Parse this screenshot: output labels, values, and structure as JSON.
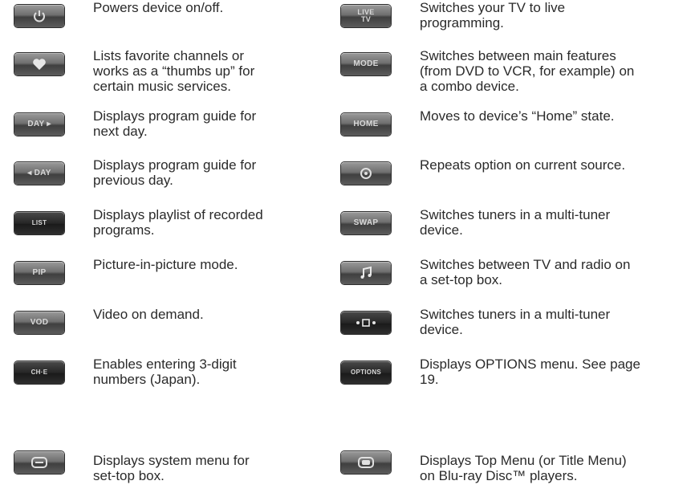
{
  "left": [
    {
      "button": "",
      "icon": "power-icon",
      "desc": "Powers device on/off."
    },
    {
      "button": "",
      "icon": "heart-icon",
      "desc": "Lists favorite channels or\nworks as a “thumbs up” for\ncertain music services."
    },
    {
      "button": "DAY ▸",
      "icon": "day-next-label",
      "desc": "Displays program guide for\nnext day."
    },
    {
      "button": "◂ DAY",
      "icon": "day-prev-label",
      "desc": "Displays program guide for\nprevious day."
    },
    {
      "button": "LIST",
      "icon": "list-label",
      "desc": "Displays playlist of recorded\nprograms."
    },
    {
      "button": "PIP",
      "icon": "pip-label",
      "desc": "Picture-in-picture mode."
    },
    {
      "button": "VOD",
      "icon": "vod-label",
      "desc": "Video on demand."
    },
    {
      "button": "CH·E",
      "icon": "ch-e-label",
      "desc": "Enables entering 3-digit\nnumbers (Japan)."
    },
    {
      "button": "",
      "icon": "menu-icon",
      "desc": "Displays system menu for\nset-top box."
    }
  ],
  "right": [
    {
      "button_top": "LIVE",
      "button_bottom": "TV",
      "icon": "live-tv-label",
      "desc": "Switches your TV to live\nprogramming."
    },
    {
      "button": "MODE",
      "icon": "mode-label",
      "desc": "Switches between main features\n(from DVD to VCR, for example) on\na combo device."
    },
    {
      "button": "HOME",
      "icon": "home-label",
      "desc": "Moves to device’s “Home” state."
    },
    {
      "button": "",
      "icon": "repeat-icon",
      "desc": "Repeats option on current source."
    },
    {
      "button": "SWAP",
      "icon": "swap-label",
      "desc": "Switches tuners in a multi-tuner\ndevice."
    },
    {
      "button": "",
      "icon": "music-note-icon",
      "desc": "Switches between TV and radio on\na set-top box."
    },
    {
      "button": "",
      "icon": "tuner-dots-icon",
      "desc": "Switches tuners in a multi-tuner\ndevice."
    },
    {
      "button": "OPTIONS",
      "icon": "options-label",
      "desc": "Displays OPTIONS menu. See page\n19."
    },
    {
      "button": "",
      "icon": "top-menu-icon",
      "desc": "Displays Top Menu (or Title Menu)\non Blu-ray Disc™ players."
    }
  ]
}
